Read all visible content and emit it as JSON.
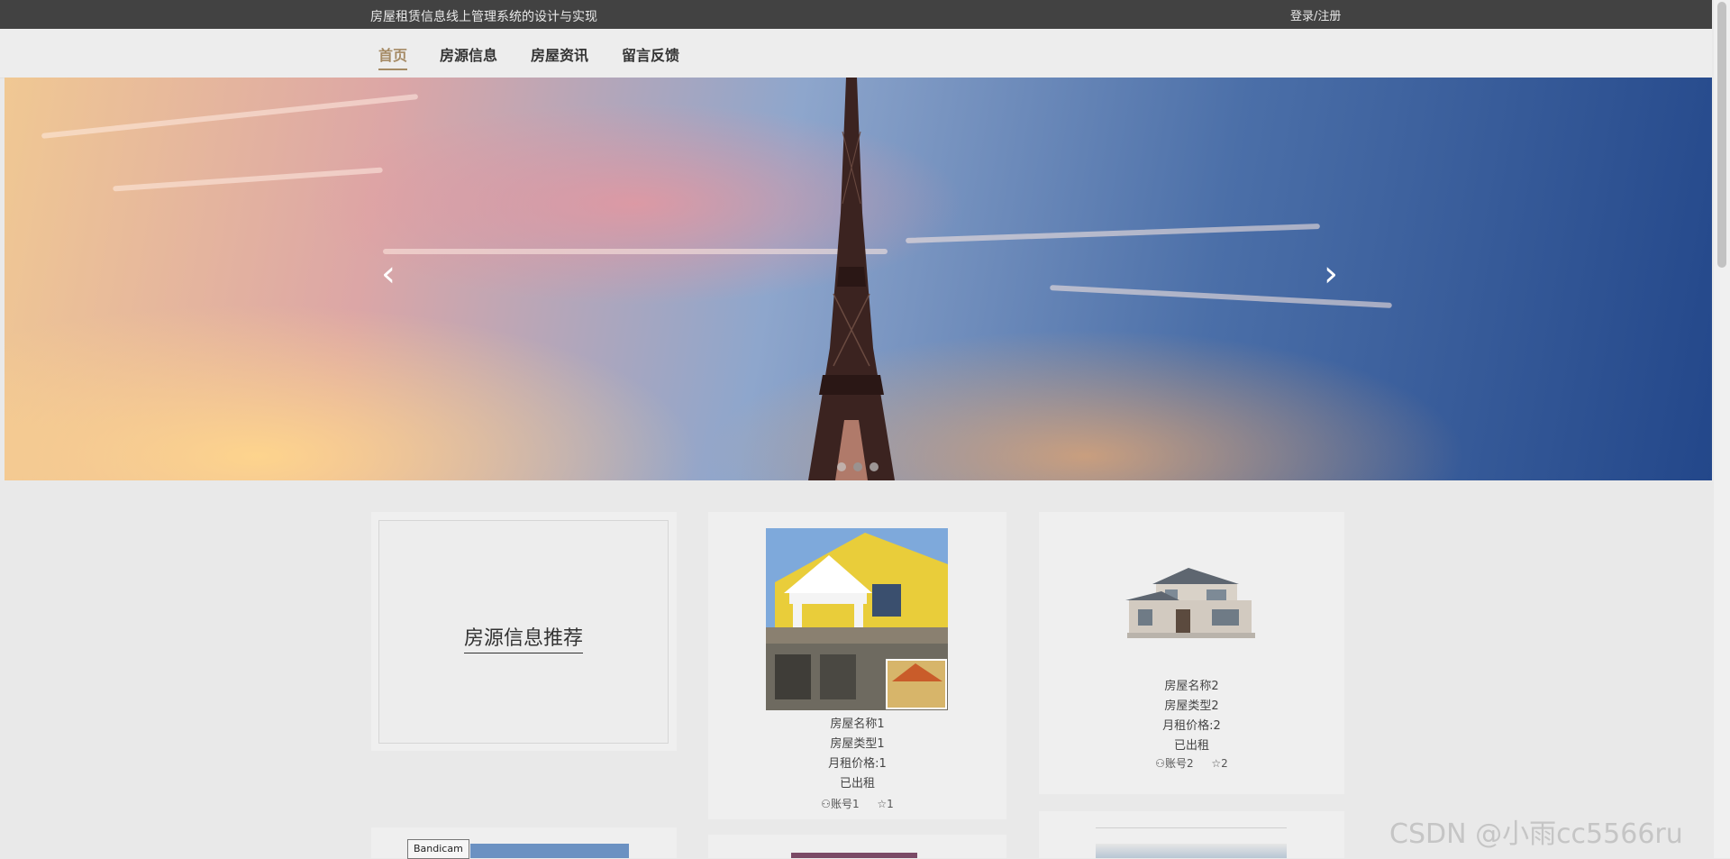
{
  "header": {
    "site_title": "房屋租赁信息线上管理系统的设计与实现",
    "login_label": "登录/注册"
  },
  "nav": {
    "items": [
      "首页",
      "房源信息",
      "房屋资讯",
      "留言反馈"
    ],
    "active_index": 0
  },
  "banner": {
    "prev_glyph": "‹",
    "next_glyph": "›",
    "slide_count": 3,
    "active_slide": 2
  },
  "recommend": {
    "title": "房源信息推荐"
  },
  "houses": [
    {
      "name": "房屋名称1",
      "type": "房屋类型1",
      "price": "月租价格:1",
      "status": "已出租",
      "account": "账号1",
      "favorites": "1"
    },
    {
      "name": "房屋名称2",
      "type": "房屋类型2",
      "price": "月租价格:2",
      "status": "已出租",
      "account": "账号2",
      "favorites": "2"
    }
  ],
  "overlay": {
    "bandicam_label": "Bandicam",
    "watermark": "CSDN @小雨cc5566ru"
  }
}
